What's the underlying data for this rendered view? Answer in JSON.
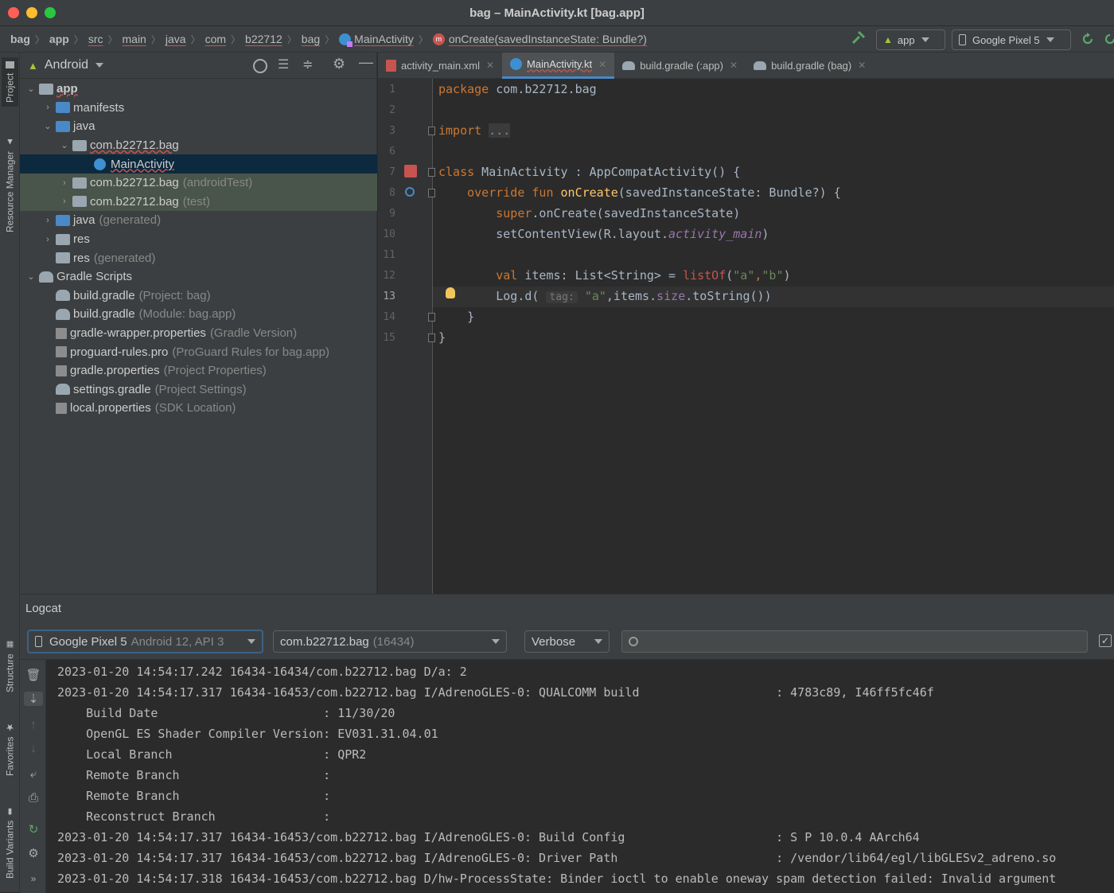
{
  "window": {
    "title": "bag – MainActivity.kt [bag.app]"
  },
  "breadcrumbs": [
    "bag",
    "app",
    "src",
    "main",
    "java",
    "com",
    "b22712",
    "bag",
    "MainActivity",
    "onCreate(savedInstanceState: Bundle?)"
  ],
  "toolbar": {
    "module": "app",
    "device": "Google Pixel 5"
  },
  "left_strip": {
    "project": "Project",
    "resource_manager": "Resource Manager",
    "structure": "Structure",
    "favorites": "Favorites",
    "build_variants": "Build Variants"
  },
  "project": {
    "view": "Android",
    "tree": [
      {
        "label": "app",
        "extra": ""
      },
      {
        "label": "manifests",
        "extra": ""
      },
      {
        "label": "java",
        "extra": ""
      },
      {
        "label": "com.b22712.bag",
        "extra": ""
      },
      {
        "label": "MainActivity",
        "extra": ""
      },
      {
        "label": "com.b22712.bag",
        "extra": "(androidTest)"
      },
      {
        "label": "com.b22712.bag",
        "extra": "(test)"
      },
      {
        "label": "java",
        "extra": "(generated)"
      },
      {
        "label": "res",
        "extra": ""
      },
      {
        "label": "res",
        "extra": "(generated)"
      },
      {
        "label": "Gradle Scripts",
        "extra": ""
      },
      {
        "label": "build.gradle",
        "extra": "(Project: bag)"
      },
      {
        "label": "build.gradle",
        "extra": "(Module: bag.app)"
      },
      {
        "label": "gradle-wrapper.properties",
        "extra": "(Gradle Version)"
      },
      {
        "label": "proguard-rules.pro",
        "extra": "(ProGuard Rules for bag.app)"
      },
      {
        "label": "gradle.properties",
        "extra": "(Project Properties)"
      },
      {
        "label": "settings.gradle",
        "extra": "(Project Settings)"
      },
      {
        "label": "local.properties",
        "extra": "(SDK Location)"
      }
    ]
  },
  "tabs": [
    {
      "label": "activity_main.xml"
    },
    {
      "label": "MainActivity.kt"
    },
    {
      "label": "build.gradle (:app)"
    },
    {
      "label": "build.gradle (bag)"
    }
  ],
  "editor": {
    "line_numbers": [
      "1",
      "2",
      "3",
      "6",
      "7",
      "8",
      "9",
      "10",
      "11",
      "12",
      "13",
      "14",
      "15"
    ],
    "code": {
      "l1_kw": "package",
      "l1_rest": " com.b22712.bag",
      "l3_kw": "import",
      "l3_rest": "...",
      "l7_kw": "class",
      "l7_rest": " MainActivity : AppCompatActivity() {",
      "l8_kw1": "override",
      "l8_kw2": "fun",
      "l8_fn": "onCreate",
      "l8_rest": "(savedInstanceState: Bundle?) {",
      "l9_kw": "super",
      "l9_rest": ".onCreate(savedInstanceState)",
      "l10_a": "setContentView(R.layout.",
      "l10_b": "activity_main",
      "l10_c": ")",
      "l12_kw": "val",
      "l12_a": " items: List<String> = ",
      "l12_fn": "listOf",
      "l12_b": "(",
      "l12_s1": "\"a\"",
      "l12_c": ",",
      "l12_s2": "\"b\"",
      "l12_d": ")",
      "l13_a": "Log.d(",
      "l13_hint": "tag:",
      "l13_s": "\"a\"",
      "l13_b": ",items.",
      "l13_prop": "size",
      "l13_c": ".toString())",
      "l14": "}",
      "l15": "}"
    }
  },
  "logcat": {
    "title": "Logcat",
    "device": "Google Pixel 5",
    "device_extra": "Android 12, API 3",
    "process": "com.b22712.bag",
    "process_pid": "(16434)",
    "level": "Verbose",
    "search_placeholder": "Q•",
    "lines": [
      "2023-01-20 14:54:17.242 16434-16434/com.b22712.bag D/a: 2",
      "2023-01-20 14:54:17.317 16434-16453/com.b22712.bag I/AdrenoGLES-0: QUALCOMM build                   : 4783c89, I46ff5fc46f",
      "    Build Date                       : 11/30/20",
      "    OpenGL ES Shader Compiler Version: EV031.31.04.01",
      "    Local Branch                     : QPR2",
      "    Remote Branch                    :",
      "    Remote Branch                    :",
      "    Reconstruct Branch               :",
      "2023-01-20 14:54:17.317 16434-16453/com.b22712.bag I/AdrenoGLES-0: Build Config                     : S P 10.0.4 AArch64",
      "2023-01-20 14:54:17.317 16434-16453/com.b22712.bag I/AdrenoGLES-0: Driver Path                      : /vendor/lib64/egl/libGLESv2_adreno.so",
      "2023-01-20 14:54:17.318 16434-16453/com.b22712.bag D/hw-ProcessState: Binder ioctl to enable oneway spam detection failed: Invalid argument"
    ]
  },
  "colors": {
    "accent": "#4a88c7",
    "selection": "#0d293e",
    "test_bg": "#49544a",
    "keyword": "#cc7832",
    "function": "#ffc66d",
    "string": "#6a8759"
  }
}
